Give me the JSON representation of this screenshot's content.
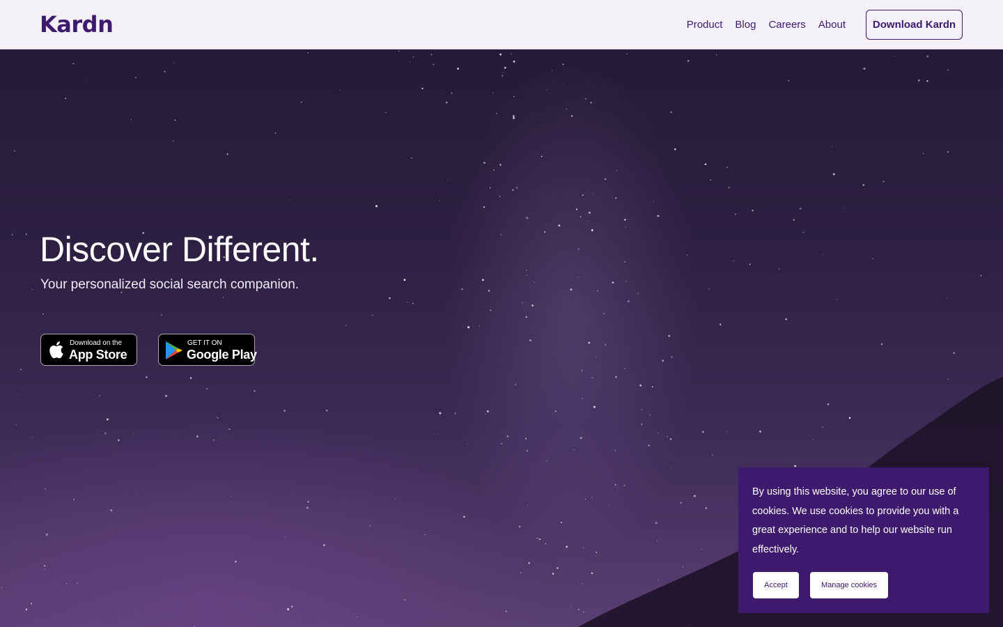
{
  "header": {
    "logo": "Kardn",
    "nav": [
      "Product",
      "Blog",
      "Careers",
      "About"
    ],
    "cta": "Download Kardn"
  },
  "hero": {
    "title": "Discover Different.",
    "subtitle": "Your personalized social search companion.",
    "app_store": {
      "small": "Download on the",
      "big": "App Store"
    },
    "google_play": {
      "small": "GET IT ON",
      "big": "Google Play"
    }
  },
  "cookie": {
    "text": "By using this website, you agree to our use of cookies. We use cookies to provide you with a great experience and to help our website run effectively.",
    "accept": "Accept",
    "manage": "Manage cookies"
  },
  "colors": {
    "brand": "#3d1a6e",
    "header_bg": "#f3f0f8",
    "cookie_bg": "#3e1a6e"
  }
}
